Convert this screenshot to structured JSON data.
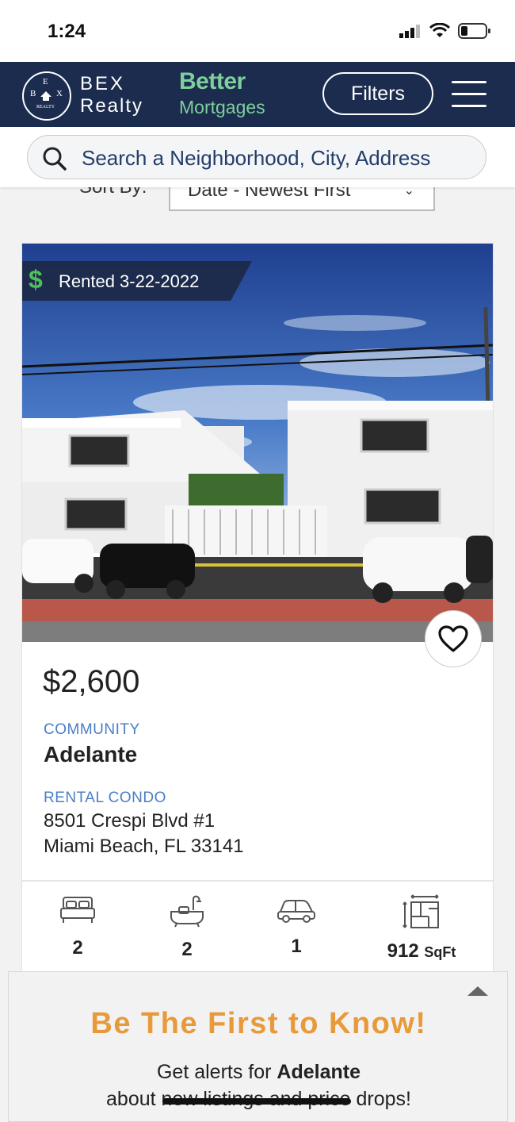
{
  "status_bar": {
    "time": "1:24"
  },
  "nav": {
    "logo_letters": {
      "top": "E",
      "left": "B",
      "right": "X",
      "bottom": "REALTY"
    },
    "brand_line1": "BEX",
    "brand_line2": "Realty",
    "mortgage_line1": "Better",
    "mortgage_line2": "Mortgages",
    "filters_label": "Filters"
  },
  "search": {
    "placeholder": "Search a Neighborhood, City, Address"
  },
  "sort": {
    "label": "Sort By:",
    "value": "Date - Newest First"
  },
  "listing": {
    "badge_icon": "$",
    "badge_text": "Rented 3-22-2022",
    "price": "$2,600",
    "community_label": "COMMUNITY",
    "community_name": "Adelante",
    "type_label": "RENTAL CONDO",
    "address_line1": "8501 Crespi Blvd #1",
    "address_line2": "Miami Beach, FL 33141",
    "features": {
      "beds": "2",
      "baths": "2",
      "parking": "1",
      "sqft": "912",
      "sqft_unit": "SqFt"
    }
  },
  "alert": {
    "title": "Be The First to Know!",
    "line1_prefix": "Get alerts for ",
    "line1_name": "Adelante",
    "line2": "about new listings and price drops!"
  },
  "colors": {
    "nav_bg": "#1b2c4f",
    "accent_green": "#7fcf9c",
    "label_blue": "#4a7fc6",
    "alert_orange": "#e89a3b"
  }
}
